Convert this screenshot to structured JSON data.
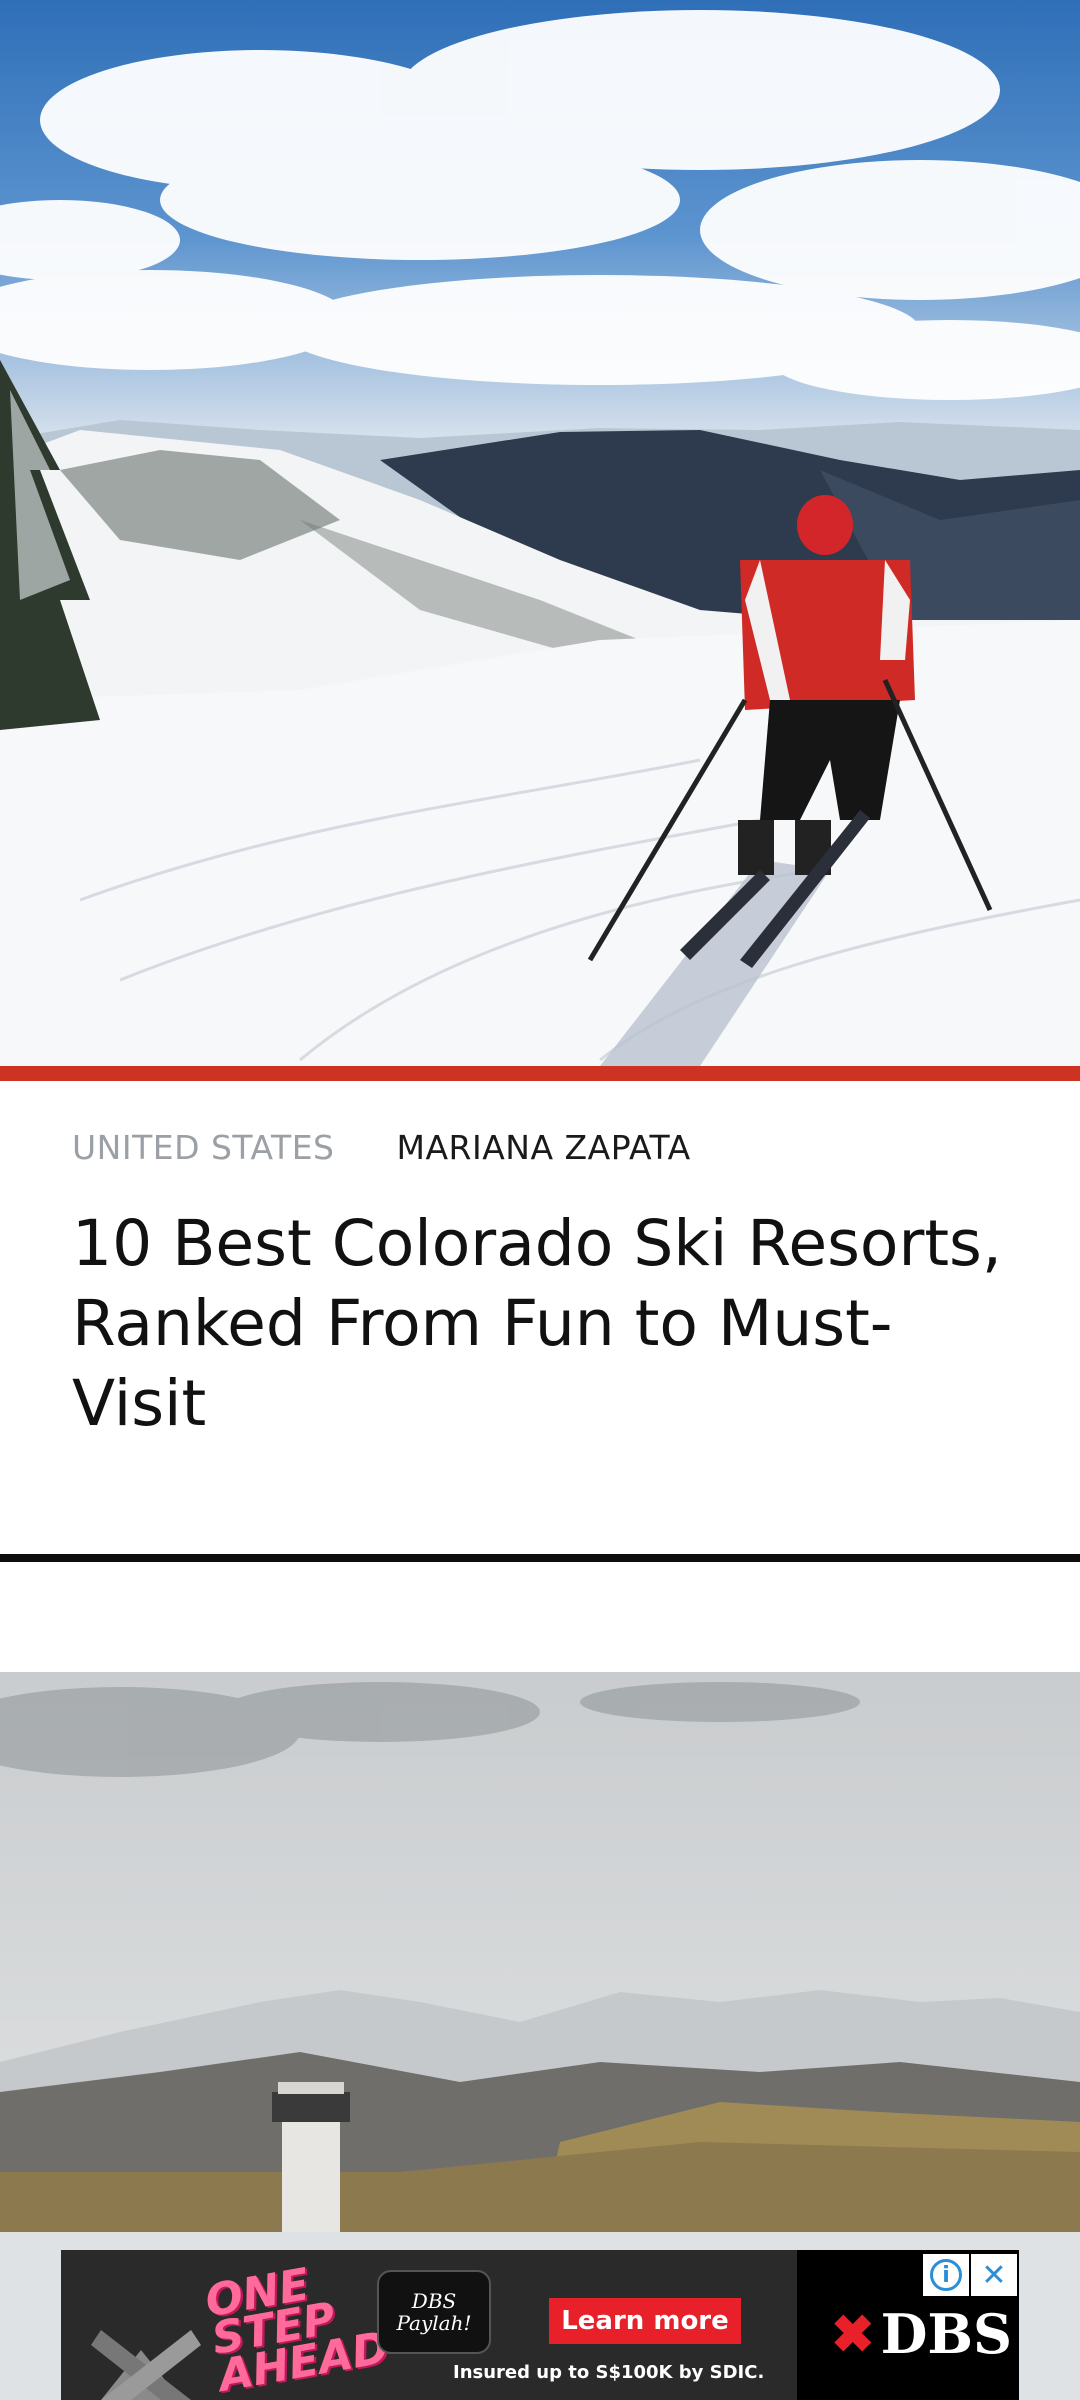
{
  "article": {
    "category": "UNITED STATES",
    "author": "MARIANA ZAPATA",
    "title": "10 Best Colorado Ski Resorts, Ranked From Fun to Must-Visit"
  },
  "ad": {
    "slogan": "ONE STEP AHEAD",
    "badge_text": "DBS Paylah!",
    "cta_label": "Learn more",
    "disclaimer": "Insured up to S$100K by SDIC.",
    "brand": "DBS",
    "info_icon": "info-icon",
    "close_icon": "close-icon",
    "accent_color": "#e8202a"
  },
  "colors": {
    "accent_bar": "#cc3322",
    "divider": "#0d0d0d",
    "category_text": "#9aa0a6"
  }
}
